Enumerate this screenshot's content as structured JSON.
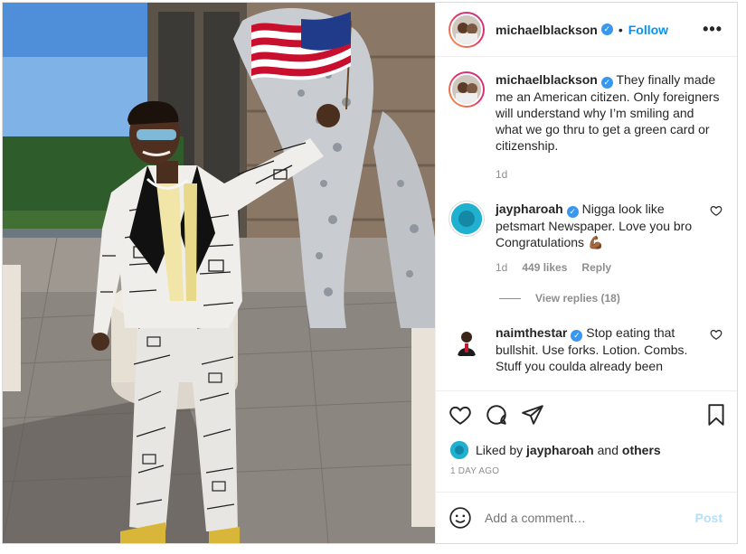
{
  "header": {
    "username": "michaelblackson",
    "separator": "•",
    "follow_label": "Follow",
    "more_label": "•••"
  },
  "caption": {
    "username": "michaelblackson",
    "text": "They finally made me an American citizen. Only foreigners will understand why I’m smiling and what we go thru to get a green card or citizenship.",
    "time": "1d"
  },
  "comments": [
    {
      "username": "jaypharoah",
      "text": "Nigga look like petsmart Newspaper. Love you bro Congratulations 💪🏾",
      "time": "1d",
      "likes": "449 likes",
      "reply_label": "Reply",
      "view_replies": "View replies (18)"
    },
    {
      "username": "naimthestar",
      "text": "Stop eating that bullshit. Use forks. Lotion. Combs. Stuff you coulda already been"
    }
  ],
  "likes_line": {
    "prefix": "Liked by ",
    "user": "jaypharoah",
    "middle": " and ",
    "others": "others"
  },
  "date": "1 DAY AGO",
  "add_comment": {
    "placeholder": "Add a comment…",
    "post_label": "Post"
  },
  "icons": {
    "verified": "verified-badge-icon",
    "like": "heart-icon",
    "comment": "speech-bubble-icon",
    "share": "paper-plane-icon",
    "save": "bookmark-icon",
    "emoji": "smiley-icon"
  },
  "colors": {
    "link_blue": "#0095f6",
    "verified_blue": "#3897f0",
    "muted": "#8e8e8e",
    "post_disabled": "#b2dffc"
  }
}
